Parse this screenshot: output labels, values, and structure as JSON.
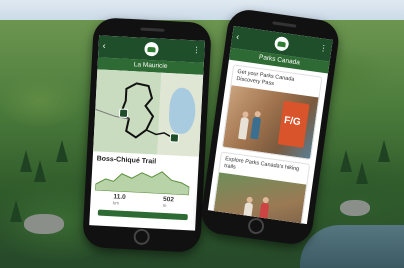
{
  "phone1": {
    "header_title": "La Mauricie",
    "trail_name": "Boss-Chiqué Trail",
    "trail_badge": "",
    "stats": [
      {
        "value": "11.0",
        "label": "km"
      },
      {
        "value": "502",
        "label": "m"
      }
    ],
    "action_button": ""
  },
  "phone2": {
    "header_title": "Parks Canada",
    "cards": [
      {
        "title": "Get your Parks Canada Discovery Pass"
      },
      {
        "title": "Explore Parks Canada's hiking trails"
      }
    ],
    "sign_text": "F/G"
  },
  "colors": {
    "app_green_dark": "#1f4f2a",
    "app_green": "#2e6b34",
    "badge_green": "#5a8f3c",
    "sign_orange": "#d9532b"
  }
}
